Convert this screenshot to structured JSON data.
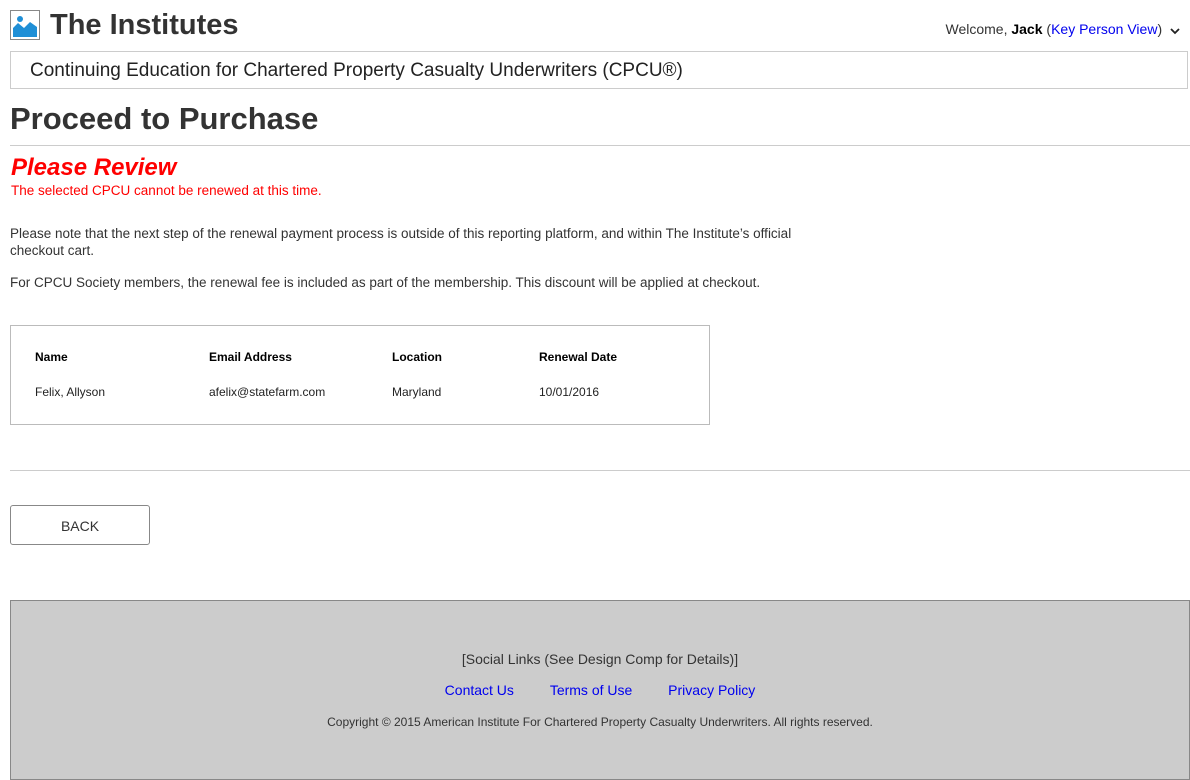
{
  "header": {
    "brand": "The Institutes",
    "logo_icon": "image-placeholder-icon",
    "welcome_prefix": "Welcome, ",
    "user_name": "Jack",
    "view_open": " (",
    "view_link": "Key Person View",
    "view_close": ")",
    "chevron_icon": "chevron-down-icon"
  },
  "course": {
    "title": "Continuing Education for Chartered Property Casualty Underwriters (CPCU®)"
  },
  "page": {
    "title": "Proceed to Purchase"
  },
  "review": {
    "title": "Please Review",
    "message": "The selected CPCU cannot be renewed at this time."
  },
  "notes": {
    "checkout_note": "Please note that the next step of the renewal payment process is outside of this reporting platform, and within The Institute’s official checkout cart.",
    "society_note": "For CPCU Society members, the renewal fee is included as part of the membership. This discount will be applied at checkout."
  },
  "table": {
    "headers": [
      "Name",
      "Email Address",
      "Location",
      "Renewal Date"
    ],
    "rows": [
      [
        "Felix, Allyson",
        "afelix@statefarm.com",
        "Maryland",
        "10/01/2016"
      ]
    ]
  },
  "actions": {
    "back_label": "BACK"
  },
  "footer": {
    "social": "[Social Links (See Design Comp for Details)]",
    "links": [
      "Contact Us",
      "Terms of Use",
      "Privacy Policy"
    ],
    "copyright": "Copyright © 2015 American Institute For Chartered Property Casualty Underwriters. All rights reserved."
  },
  "colors": {
    "accent_link": "#0000ee",
    "error": "#ff0000",
    "logo_blue": "#1f8fd6",
    "footer_bg": "#cccccc"
  }
}
